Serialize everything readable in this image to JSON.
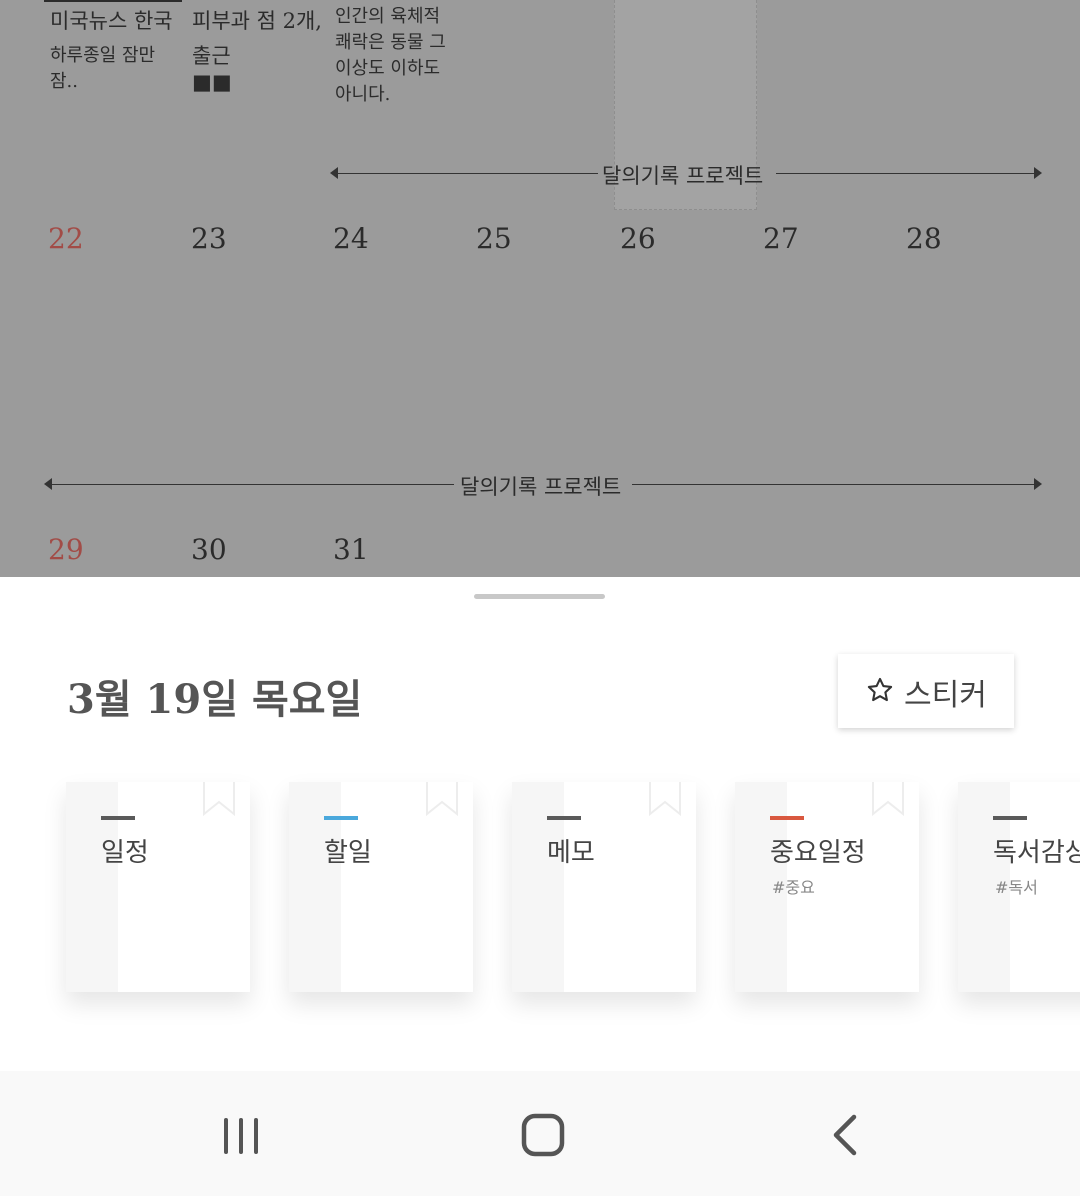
{
  "calendar": {
    "events_row1": [
      {
        "title": "미국뉴스 한국",
        "sub": "하루종일 잠만 잠.."
      },
      {
        "title": "피부과 점 2개,",
        "sub": "출근 ■■"
      },
      {
        "title": "인간의 육체적 쾌락은 동물 그 이상도 이하도 아니다.",
        "sub": ""
      }
    ],
    "project_label_1": "달의기록 프로젝트",
    "days_row2": [
      "22",
      "23",
      "24",
      "25",
      "26",
      "27",
      "28"
    ],
    "project_label_2": "달의기록 프로젝트",
    "days_row3": [
      "29",
      "30",
      "31"
    ]
  },
  "sheet": {
    "date_title": "3월 19일 목요일",
    "sticker_label": "스티커",
    "cards": [
      {
        "name": "일정",
        "tag": "",
        "bar_color": "#5a5a5a"
      },
      {
        "name": "할일",
        "tag": "",
        "bar_color": "#4aa8dc"
      },
      {
        "name": "메모",
        "tag": "",
        "bar_color": "#5a5a5a"
      },
      {
        "name": "중요일정",
        "tag": "#중요",
        "bar_color": "#d9583f"
      },
      {
        "name": "독서감상",
        "tag": "#독서",
        "bar_color": "#5a5a5a"
      }
    ]
  },
  "navbar": {
    "icons": [
      "recent-apps-icon",
      "home-icon",
      "back-icon"
    ]
  },
  "colors": {
    "sunday": "#a24c47",
    "overlay": "#9b9b9b"
  }
}
